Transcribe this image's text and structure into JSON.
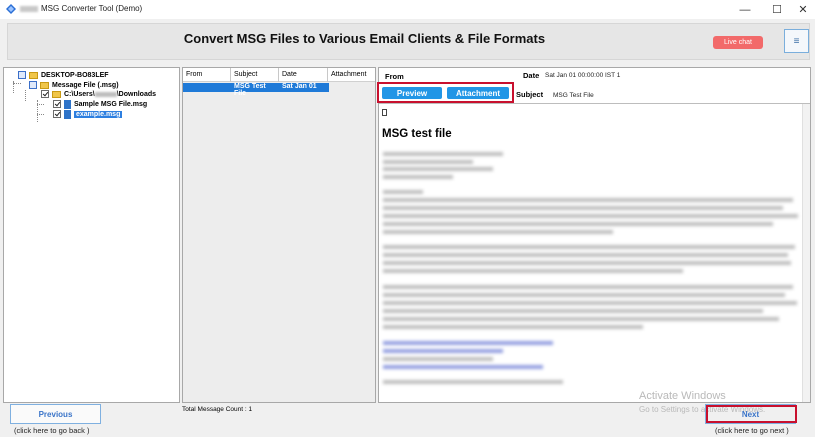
{
  "window": {
    "title": "MSG Converter Tool (Demo)",
    "controls": {
      "minimize": "—",
      "maximize": "☐",
      "close": "✕"
    }
  },
  "header": {
    "headline": "Convert MSG Files to Various Email Clients & File Formats",
    "live_chat": "Live chat",
    "menu_icon": "≡",
    "live_chat_color": "#f26a6a"
  },
  "tree": {
    "root": "DESKTOP-BO83LEF",
    "message_file": "Message File (.msg)",
    "folder_prefix": "C:\\Users\\",
    "folder_suffix": "\\Downloads",
    "files": [
      "Sample MSG File.msg",
      "example.msg"
    ]
  },
  "list": {
    "columns": [
      "From",
      "Subject",
      "Date",
      "Attachment"
    ],
    "rows": [
      {
        "from": "",
        "subject": "MSG Test File",
        "date": "Sat Jan 01",
        "attachment": ""
      }
    ],
    "selected_row_color": "#1f7ad8",
    "total_label": "Total Message Count : 1"
  },
  "preview": {
    "from_label": "From",
    "date_label": "Date",
    "date_value": "Sat Jan 01 00:00:00 IST 1",
    "subject_label": "Subject",
    "subject_value": "MSG Test File",
    "tabs": [
      "Preview",
      "Attachment"
    ],
    "body_title": "MSG test file",
    "glyph": "▯",
    "accent_color": "#2196e6",
    "highlight_color": "#c8102e"
  },
  "footer": {
    "previous_label": "Previous",
    "previous_hint": "(click here to  go back )",
    "next_label": "Next",
    "next_hint": "(click here to  go next )"
  },
  "watermark": {
    "line1": "Activate Windows",
    "line2": "Go to Settings to activate Windows."
  }
}
